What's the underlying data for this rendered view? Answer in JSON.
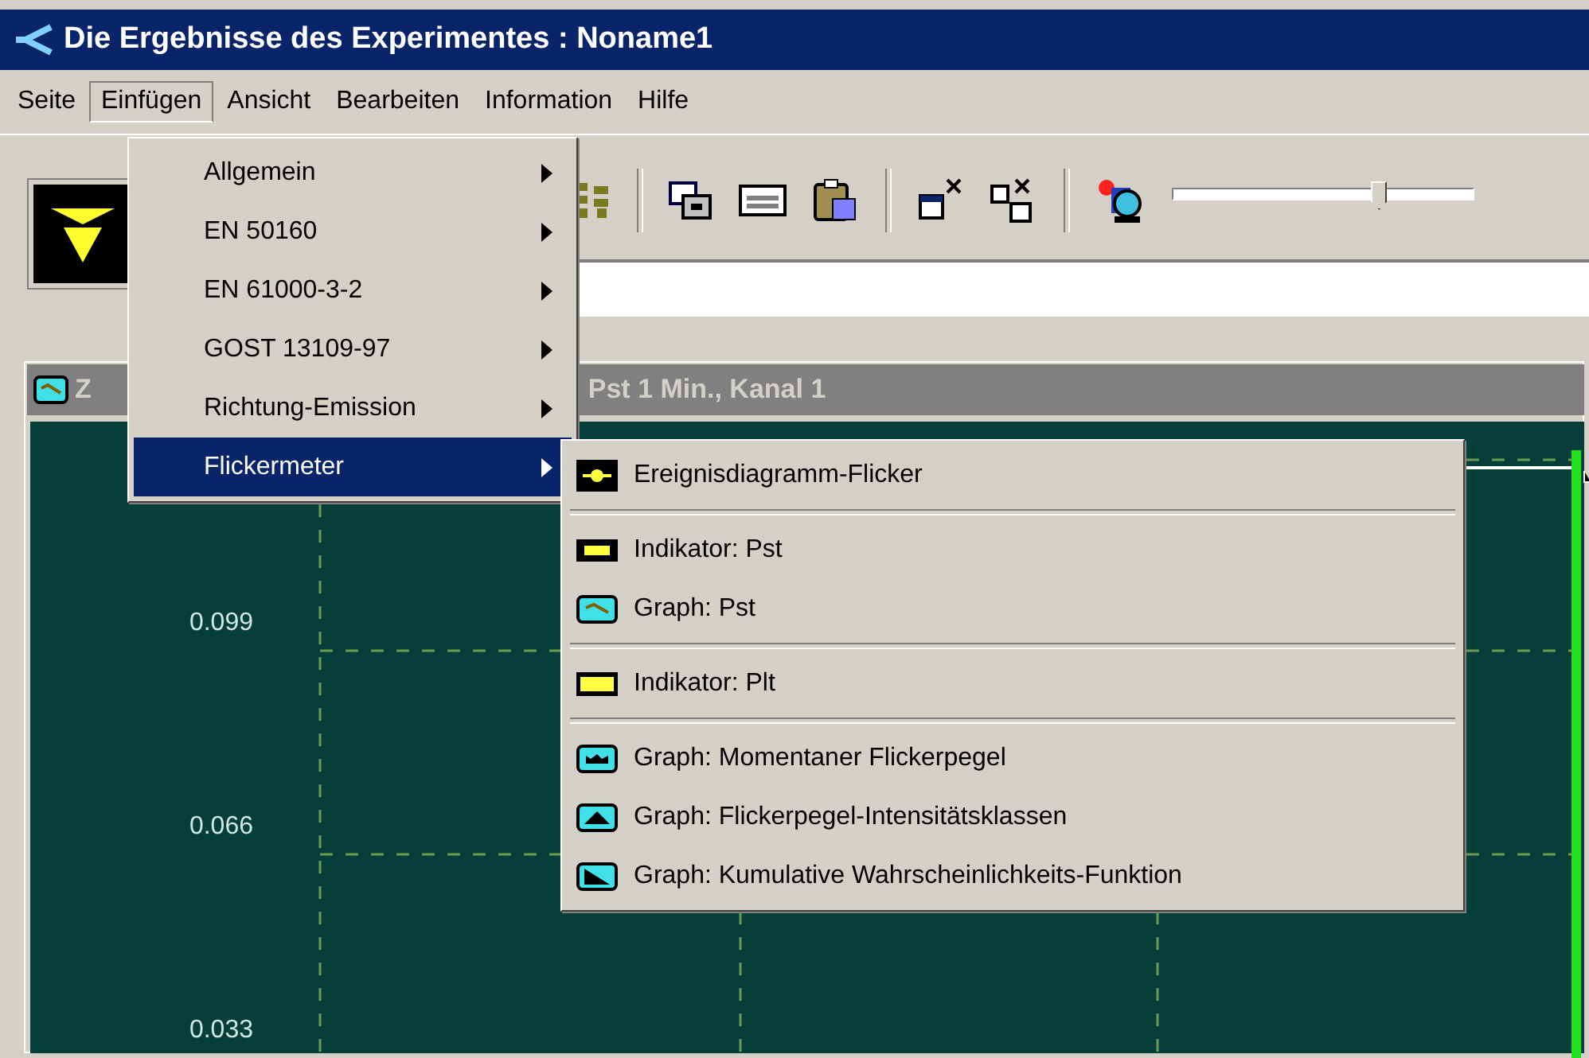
{
  "window": {
    "title": "Die Ergebnisse des Experimentes : Noname1"
  },
  "menubar": [
    {
      "label": "Seite",
      "selected": false
    },
    {
      "label": "Einfügen",
      "selected": true
    },
    {
      "label": "Ansicht",
      "selected": false
    },
    {
      "label": "Bearbeiten",
      "selected": false
    },
    {
      "label": "Information",
      "selected": false
    },
    {
      "label": "Hilfe",
      "selected": false
    }
  ],
  "toolbar": {
    "slider": {
      "level": 0.68
    }
  },
  "child_window": {
    "title_start": "Z",
    "title_end": "Pst 1  Min., Kanal 1",
    "y_labels": [
      "0.099",
      "0.066",
      "0.033"
    ]
  },
  "menu": [
    {
      "kind": "item",
      "label": "Allgemein",
      "selected": false
    },
    {
      "kind": "item",
      "label": "EN 50160",
      "selected": false
    },
    {
      "kind": "item",
      "label": "EN 61000-3-2",
      "selected": false
    },
    {
      "kind": "item",
      "label": "GOST 13109-97",
      "selected": false
    },
    {
      "kind": "item",
      "label": "Richtung-Emission",
      "selected": false
    },
    {
      "kind": "item",
      "label": "Flickermeter",
      "selected": true
    }
  ],
  "submenu": [
    {
      "kind": "item",
      "label": "Ereignisdiagramm-Flicker"
    },
    {
      "kind": "separator"
    },
    {
      "kind": "item",
      "label": "Indikator: Pst"
    },
    {
      "kind": "item",
      "label": "Graph: Pst"
    },
    {
      "kind": "separator"
    },
    {
      "kind": "item",
      "label": "Indikator: Plt"
    },
    {
      "kind": "separator"
    },
    {
      "kind": "item",
      "label": "Graph: Momentaner Flickerpegel"
    },
    {
      "kind": "item",
      "label": "Graph: Flickerpegel-Intensitätsklassen"
    },
    {
      "kind": "item",
      "label": "Graph: Kumulative Wahrscheinlichkeits-Funktion"
    }
  ]
}
